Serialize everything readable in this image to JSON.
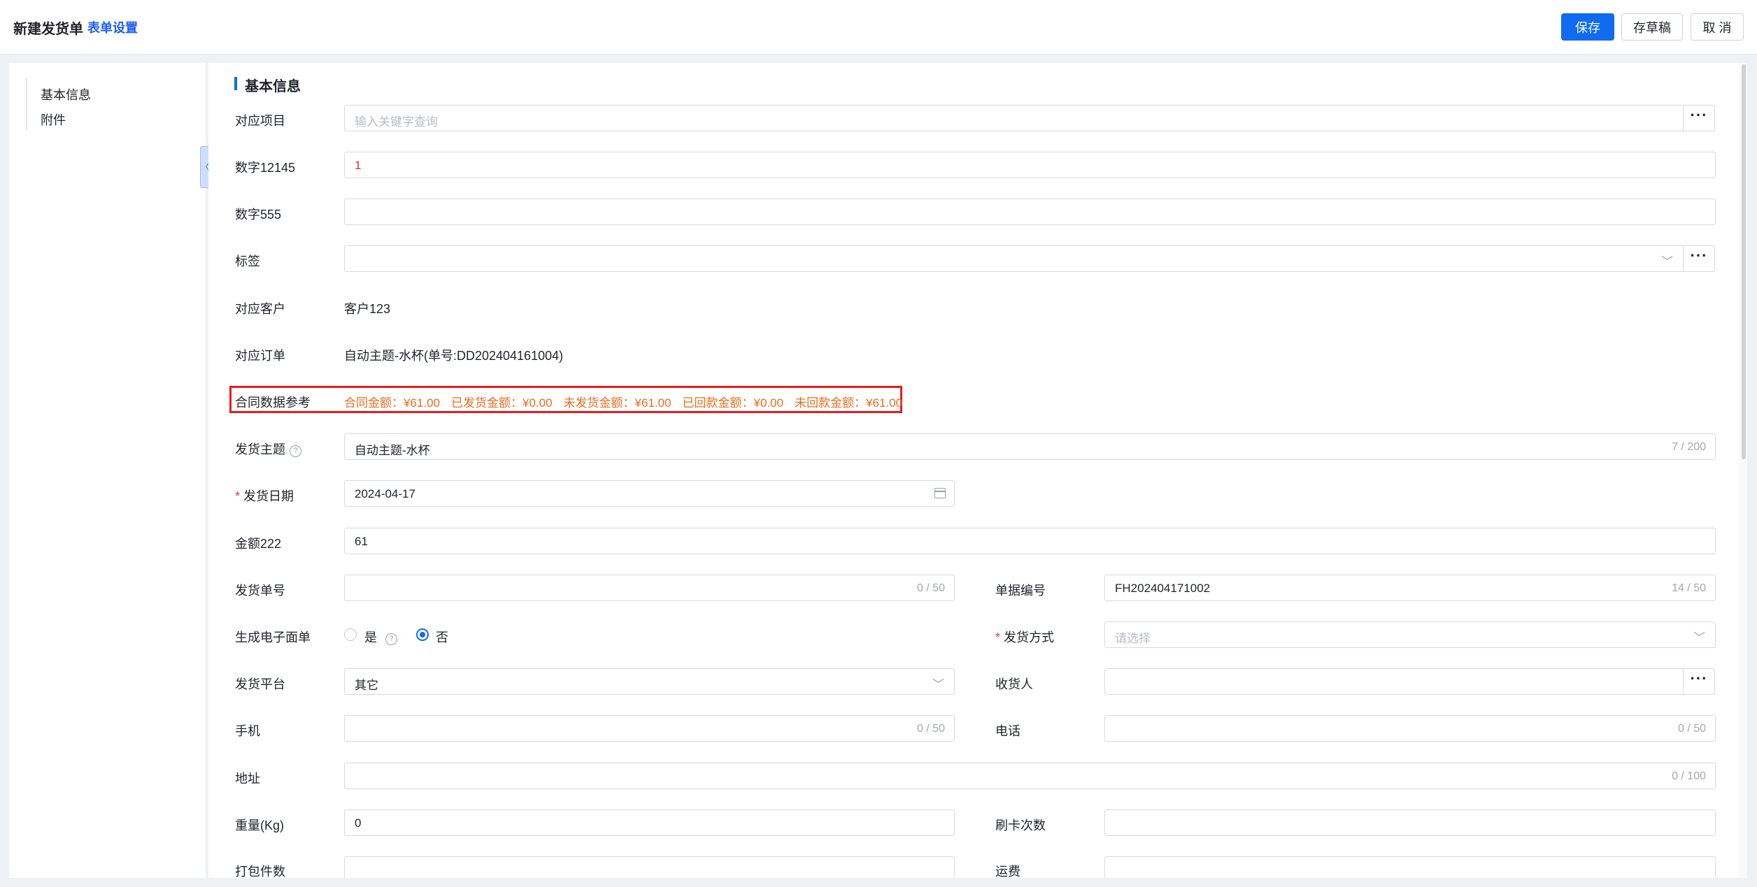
{
  "header": {
    "title": "新建发货单",
    "form_settings": "表单设置",
    "buttons": {
      "save": "保存",
      "draft": "存草稿",
      "cancel": "取 消"
    }
  },
  "nav": {
    "items": [
      "基本信息",
      "附件"
    ],
    "collapse": "〈"
  },
  "section_title": "基本信息",
  "fields": {
    "project": {
      "label": "对应项目",
      "placeholder": "输入关键字查询"
    },
    "num12145": {
      "label": "数字12145",
      "value": "1"
    },
    "num555": {
      "label": "数字555",
      "value": ""
    },
    "tags": {
      "label": "标签",
      "value": ""
    },
    "customer": {
      "label": "对应客户",
      "value": "客户123"
    },
    "order": {
      "label": "对应订单",
      "value": "自动主题-水杯(单号:DD202404161004)"
    },
    "contract_ref": {
      "label": "合同数据参考",
      "items": [
        "合同金额：¥61.00",
        "已发货金额：¥0.00",
        "未发货金额：¥61.00",
        "已回款金额：¥0.00",
        "未回款金额：¥61.00"
      ]
    },
    "subject": {
      "label": "发货主题",
      "value": "自动主题-水杯",
      "counter": "7 / 200"
    },
    "ship_date": {
      "label": "发货日期",
      "value": "2024-04-17"
    },
    "amount": {
      "label": "金额222",
      "value": "61"
    },
    "ship_no": {
      "label": "发货单号",
      "value": "",
      "counter": "0 / 50"
    },
    "doc_no": {
      "label": "单据编号",
      "value": "FH202404171002",
      "counter": "14 / 50"
    },
    "e_waybill": {
      "label": "生成电子面单",
      "option_yes": "是",
      "option_no": "否",
      "selected": "否"
    },
    "ship_method": {
      "label": "发货方式",
      "placeholder": "请选择"
    },
    "platform": {
      "label": "发货平台",
      "value": "其它"
    },
    "receiver": {
      "label": "收货人",
      "value": ""
    },
    "mobile": {
      "label": "手机",
      "value": "",
      "counter": "0 / 50"
    },
    "phone": {
      "label": "电话",
      "value": "",
      "counter": "0 / 50"
    },
    "address": {
      "label": "地址",
      "value": "",
      "counter": "0 / 100"
    },
    "weight": {
      "label": "重量(Kg)",
      "value": "0"
    },
    "card_times": {
      "label": "刷卡次数",
      "value": ""
    },
    "packages": {
      "label": "打包件数",
      "value": ""
    },
    "freight": {
      "label": "运费",
      "value": ""
    }
  },
  "required_mark": "*",
  "colors": {
    "primary": "#0f6bf0",
    "highlight_border": "#e51d1d",
    "contract_text": "#e66d1f"
  }
}
